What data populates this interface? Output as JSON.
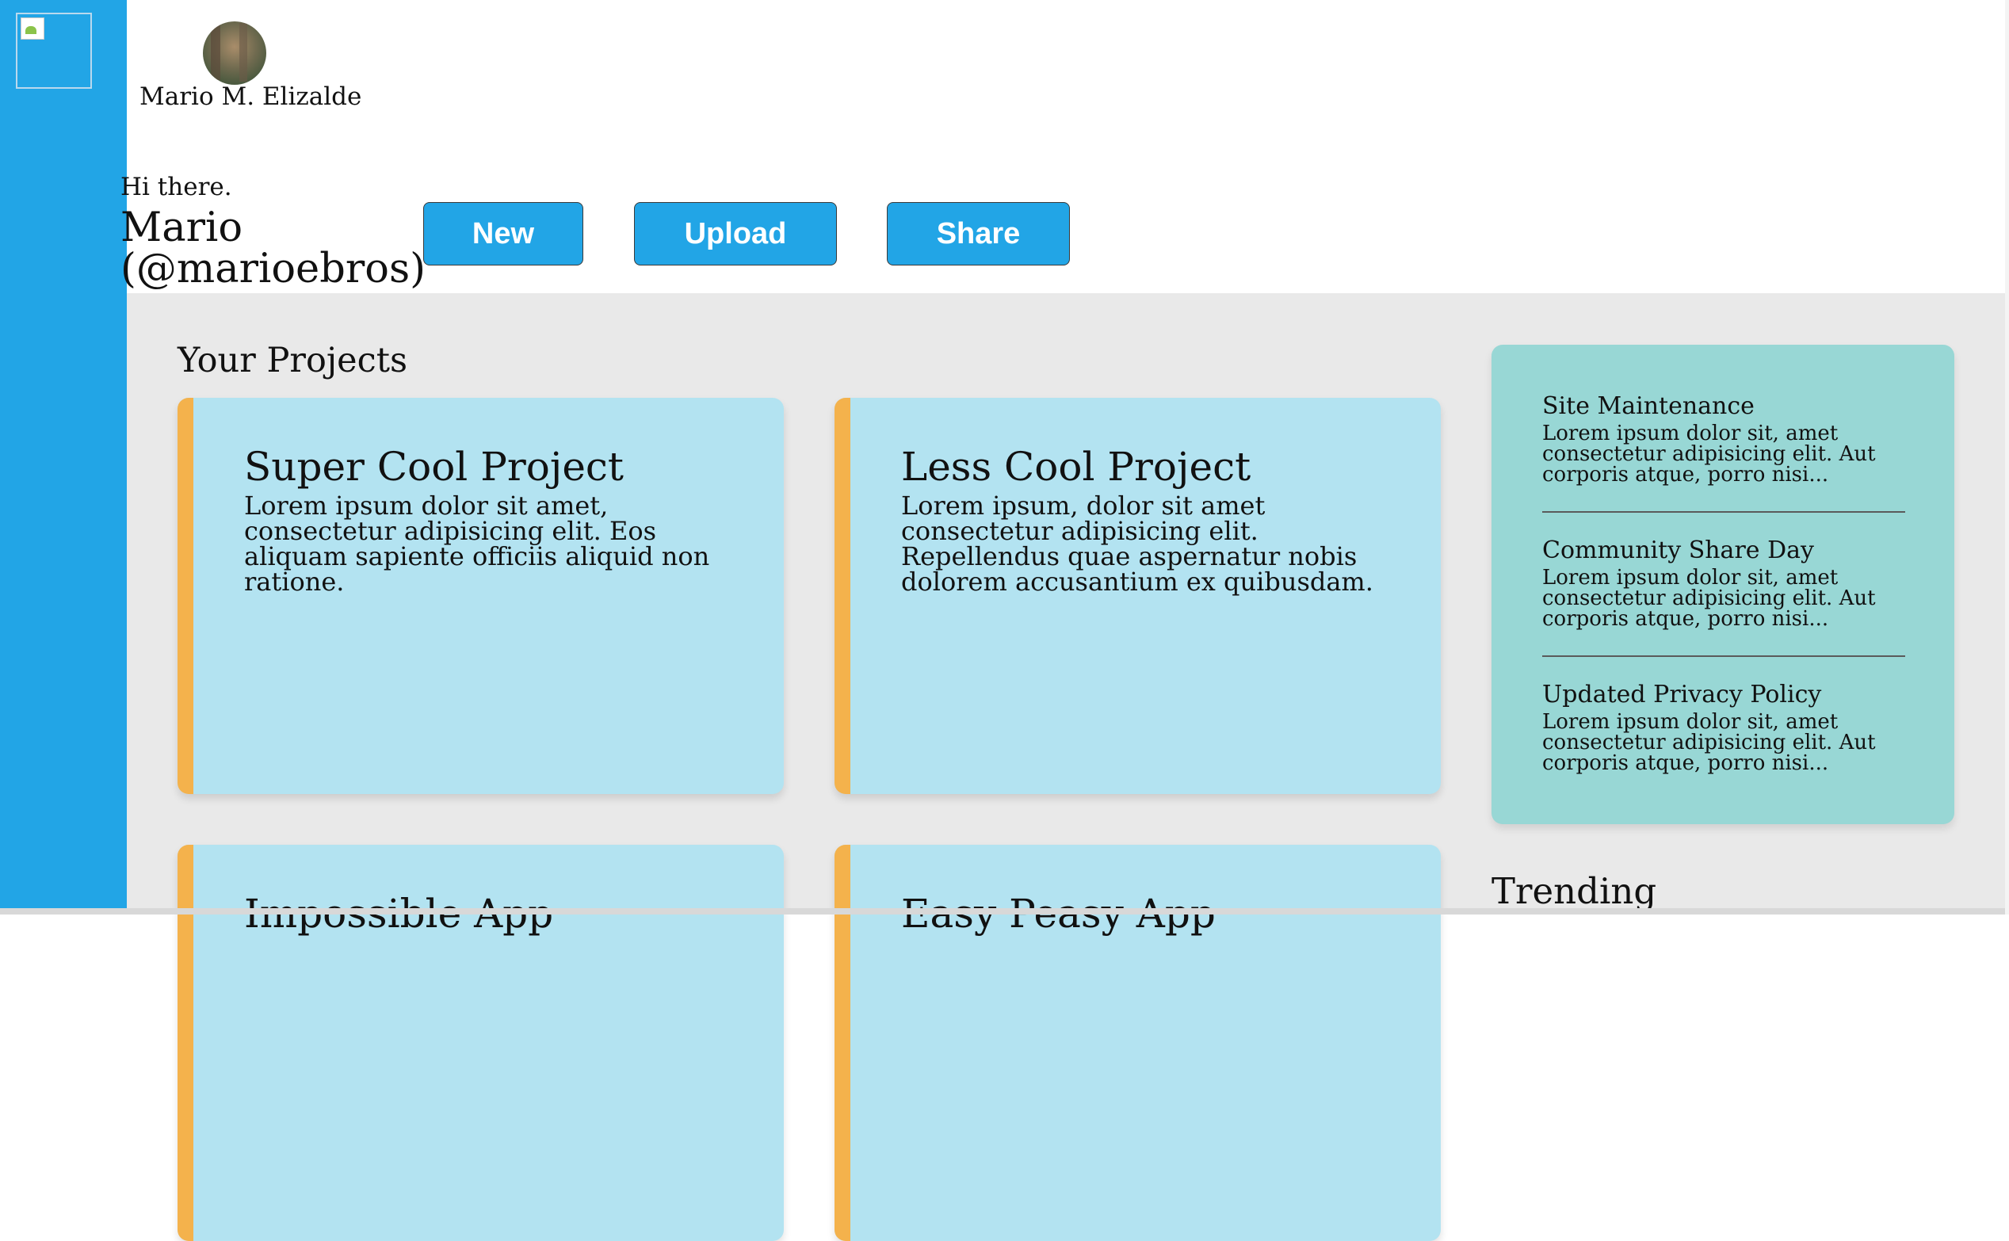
{
  "profile": {
    "name": "Mario M. Elizalde",
    "greeting": "Hi there.",
    "handle": "Mario (@marioebros)"
  },
  "toolbar": {
    "new_label": "New",
    "upload_label": "Upload",
    "share_label": "Share"
  },
  "projects": {
    "title": "Your Projects",
    "items": [
      {
        "title": "Super Cool Project",
        "body": "Lorem ipsum dolor sit amet, consectetur adipisicing elit. Eos aliquam sapiente officiis aliquid non ratione."
      },
      {
        "title": "Less Cool Project",
        "body": "Lorem ipsum, dolor sit amet consectetur adipisicing elit. Repellendus quae aspernatur nobis dolorem accusantium ex quibusdam."
      },
      {
        "title": "Impossible App",
        "body": ""
      },
      {
        "title": "Easy Peasy App",
        "body": ""
      }
    ]
  },
  "announcements": {
    "items": [
      {
        "title": "Site Maintenance",
        "body": "Lorem ipsum dolor sit, amet consectetur adipisicing elit. Aut corporis atque, porro nisi..."
      },
      {
        "title": "Community Share Day",
        "body": "Lorem ipsum dolor sit, amet consectetur adipisicing elit. Aut corporis atque, porro nisi..."
      },
      {
        "title": "Updated Privacy Policy",
        "body": "Lorem ipsum dolor sit, amet consectetur adipisicing elit. Aut corporis atque, porro nisi..."
      }
    ]
  },
  "trending": {
    "title": "Trending"
  },
  "colors": {
    "sidebar": "#22a5e6",
    "button": "#22a5e6",
    "card": "#b3e3f1",
    "card_accent": "#f4b24c",
    "announcements": "#98d7d5",
    "main_bg": "#e9e9e9"
  }
}
